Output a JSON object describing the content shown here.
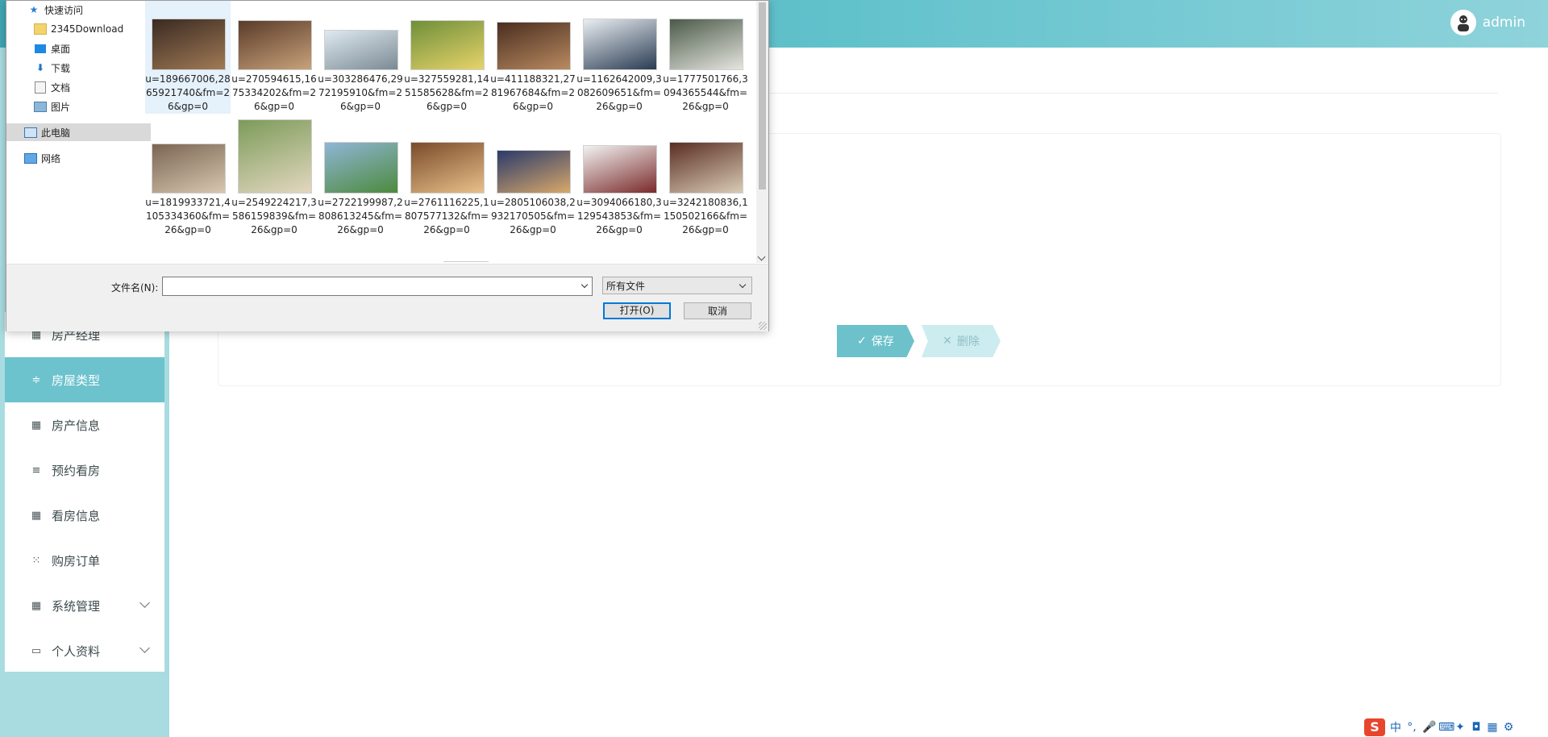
{
  "header": {
    "user_name": "admin"
  },
  "sidebar": {
    "items": [
      {
        "label": "房产经理",
        "icon": "grid-icon",
        "active": false
      },
      {
        "label": "房屋类型",
        "icon": "sliders-icon",
        "active": true
      },
      {
        "label": "房产信息",
        "icon": "grid-icon",
        "active": false
      },
      {
        "label": "预约看房",
        "icon": "list-icon",
        "active": false
      },
      {
        "label": "看房信息",
        "icon": "grid-icon",
        "active": false
      },
      {
        "label": "购房订单",
        "icon": "apps-icon",
        "active": false
      },
      {
        "label": "系统管理",
        "icon": "grid-icon",
        "active": false,
        "expandable": true
      },
      {
        "label": "个人资料",
        "icon": "card-icon",
        "active": false,
        "expandable": true
      }
    ]
  },
  "form": {
    "save_label": "保存",
    "delete_label": "删除"
  },
  "dialog": {
    "tree": [
      {
        "label": "快速访问",
        "icon": "star-icon",
        "pinned": false
      },
      {
        "label": "2345Download",
        "icon": "folder-icon",
        "pinned": true
      },
      {
        "label": "桌面",
        "icon": "desktop-icon",
        "pinned": true
      },
      {
        "label": "下载",
        "icon": "download-icon",
        "pinned": true
      },
      {
        "label": "文档",
        "icon": "document-icon",
        "pinned": true
      },
      {
        "label": "图片",
        "icon": "pictures-icon",
        "pinned": true
      },
      {
        "label": "此电脑",
        "icon": "computer-icon",
        "pinned": false,
        "selected": true
      },
      {
        "label": "网络",
        "icon": "network-icon",
        "pinned": false
      }
    ],
    "files": [
      {
        "name": "u=189667006,2865921740&fm=26&gp=0",
        "selected": true,
        "colors": [
          "#3a2a22",
          "#a07a55"
        ]
      },
      {
        "name": "u=270594615,1675334202&fm=26&gp=0",
        "colors": [
          "#5a3b2a",
          "#c8a27a"
        ]
      },
      {
        "name": "u=303286476,2972195910&fm=26&gp=0",
        "colors": [
          "#dfe9f0",
          "#7a8a94"
        ]
      },
      {
        "name": "u=327559281,1451585628&fm=26&gp=0",
        "colors": [
          "#6f8f3a",
          "#e7d36a"
        ]
      },
      {
        "name": "u=411188321,2781967684&fm=26&gp=0",
        "colors": [
          "#4a2e20",
          "#b98a60"
        ]
      },
      {
        "name": "u=1162642009,3082609651&fm=26&gp=0",
        "colors": [
          "#e9eef2",
          "#2a3b52"
        ]
      },
      {
        "name": "u=1777501766,3094365544&fm=26&gp=0",
        "colors": [
          "#4b5a48",
          "#e5e5e0"
        ]
      },
      {
        "name": "u=1819933721,4105334360&fm=26&gp=0",
        "colors": [
          "#7a6552",
          "#d8c7b0"
        ]
      },
      {
        "name": "u=2549224217,3586159839&fm=26&gp=0",
        "colors": [
          "#7c9b5a",
          "#e3d7bf"
        ]
      },
      {
        "name": "u=2722199987,2808613245&fm=26&gp=0",
        "colors": [
          "#8fb6d6",
          "#4d8a3d"
        ]
      },
      {
        "name": "u=2761116225,1807577132&fm=26&gp=0",
        "colors": [
          "#7a4b2a",
          "#e8c08a"
        ]
      },
      {
        "name": "u=2805106038,2932170505&fm=26&gp=0",
        "colors": [
          "#2a3a6a",
          "#d8a86a"
        ]
      },
      {
        "name": "u=3094066180,3129543853&fm=26&gp=0",
        "colors": [
          "#f2f2f2",
          "#7a2a2a"
        ]
      },
      {
        "name": "u=3242180836,1150502166&fm=26&gp=0",
        "colors": [
          "#5a2e22",
          "#d9cbb5"
        ]
      }
    ],
    "filename_label": "文件名(N):",
    "filename_value": "",
    "filetype_value": "所有文件",
    "open_label": "打开(O)",
    "cancel_label": "取消"
  },
  "tray": {
    "ime_logo": "S",
    "lang": "中",
    "punct": "°,",
    "icons": [
      "mic-icon",
      "keyboard-icon",
      "skin-icon",
      "toolbox-icon",
      "grid-icon",
      "settings-icon"
    ]
  }
}
